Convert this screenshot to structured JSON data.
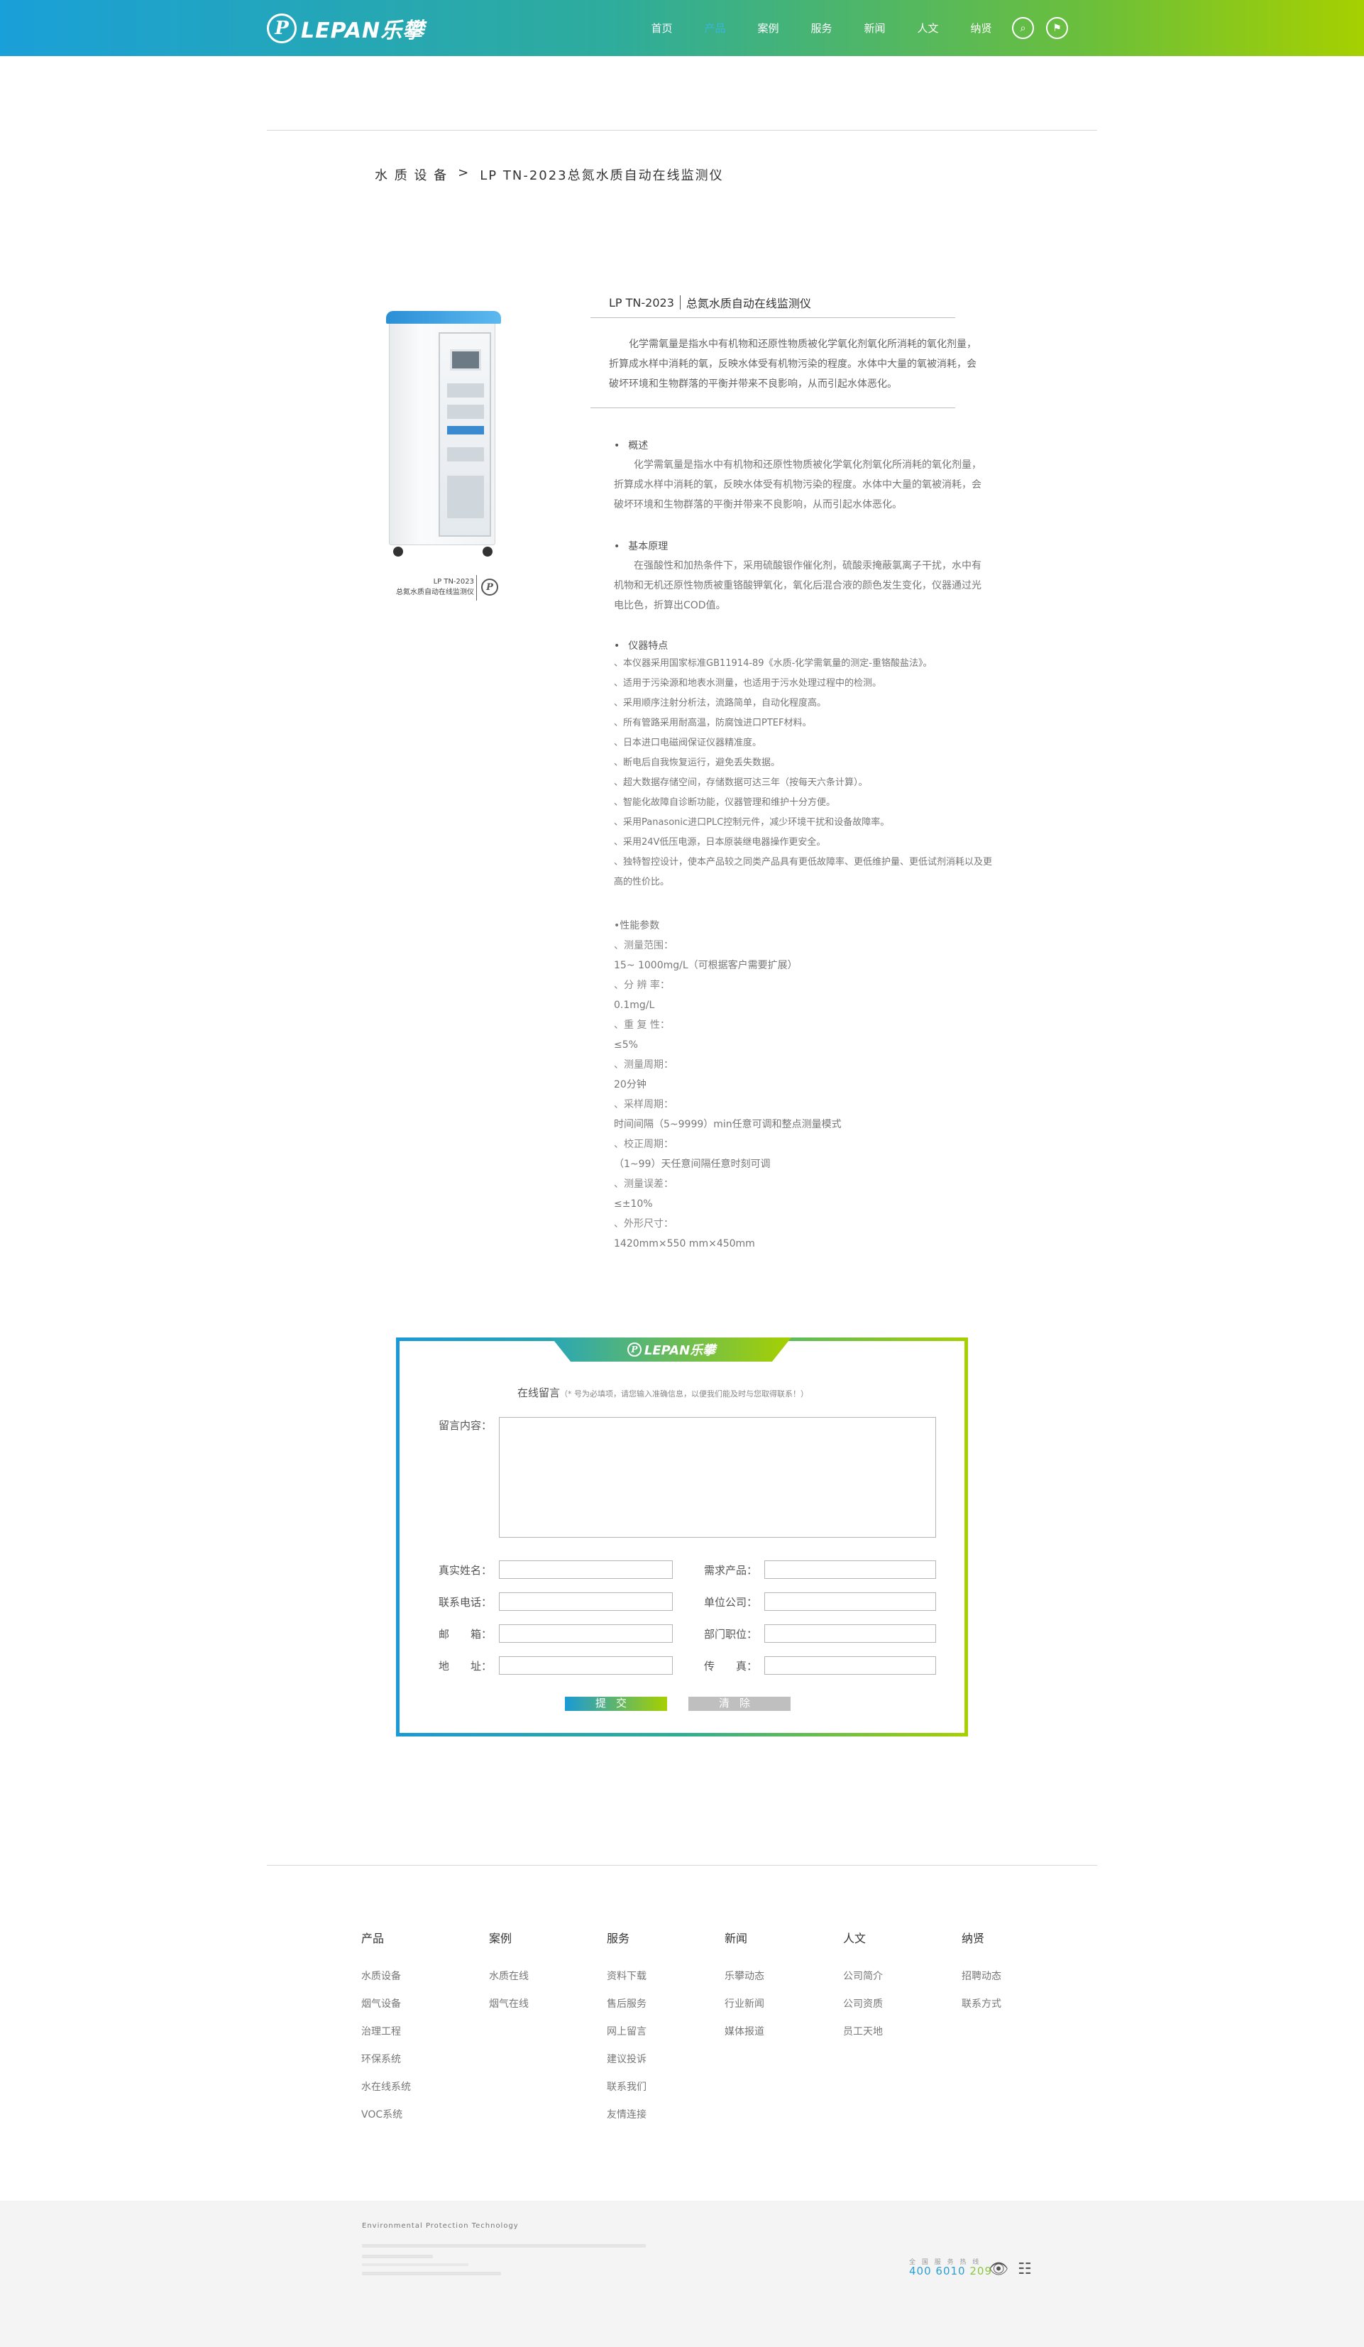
{
  "header": {
    "logo_text": "LEPAN乐攀",
    "logo_mark": "P",
    "nav": [
      "首页",
      "产品",
      "案例",
      "服务",
      "新闻",
      "人文",
      "纳贤"
    ],
    "active_index": 1,
    "search_icon": "search-icon",
    "flag_icon": "flag-icon"
  },
  "breadcrumb": {
    "category": "水 质 设 备",
    "separator": ">",
    "current": "LP TN-2023总氮水质自动在线监测仪"
  },
  "product": {
    "image_caption_model": "LP TN-2023",
    "image_caption_name": "总氮水质自动在线监测仪",
    "title_model": "LP TN-2023",
    "title_name": "总氮水质自动在线监测仪",
    "intro": "化学需氧量是指水中有机物和还原性物质被化学氧化剂氧化所消耗的氧化剂量，折算成水样中消耗的氧，反映水体受有机物污染的程度。水体中大量的氧被消耗，会破坏环境和生物群落的平衡并带来不良影响，从而引起水体恶化。",
    "overview_title": "概述",
    "overview_text": "化学需氧量是指水中有机物和还原性物质被化学氧化剂氧化所消耗的氧化剂量，折算成水样中消耗的氧，反映水体受有机物污染的程度。水体中大量的氧被消耗，会破坏环境和生物群落的平衡并带来不良影响，从而引起水体恶化。",
    "principle_title": "基本原理",
    "principle_text": "在强酸性和加热条件下，采用硫酸银作催化剂，硫酸汞掩蔽氯离子干扰，水中有机物和无机还原性物质被重铬酸钾氧化，氧化后混合液的颜色发生变化，仪器通过光电比色，折算出COD值。",
    "features_title": "仪器特点",
    "features": [
      "、本仪器采用国家标准GB11914-89《水质-化学需氧量的测定-重铬酸盐法》。",
      "、适用于污染源和地表水测量，也适用于污水处理过程中的检测。",
      "、采用顺序注射分析法，流路简单，自动化程度高。",
      "、所有管路采用耐高温，防腐蚀进口PTEF材料。",
      "、日本进口电磁阀保证仪器精准度。",
      "、断电后自我恢复运行，避免丢失数据。",
      "、超大数据存储空间，存储数据可达三年（按每天六条计算）。",
      "、智能化故障自诊断功能，仪器管理和维护十分方便。",
      "、采用Panasonic进口PLC控制元件，减少环境干扰和设备故障率。",
      "、采用24V低压电源，日本原装继电器操作更安全。",
      "、独特智控设计，使本产品较之同类产品具有更低故障率、更低维护量、更低试剂消耗以及更高的性价比。"
    ],
    "specs_title": "•性能参数",
    "specs": [
      {
        "label": "、测量范围：",
        "value": "15~ 1000mg/L（可根据客户需要扩展）"
      },
      {
        "label": "、分 辨 率：",
        "value": "0.1mg/L"
      },
      {
        "label": "、重 复 性：",
        "value": "≤5%"
      },
      {
        "label": "、测量周期：",
        "value": "20分钟"
      },
      {
        "label": "、采样周期：",
        "value": "时间间隔（5~9999）min任意可调和整点测量模式"
      },
      {
        "label": "、校正周期：",
        "value": "（1~99）天任意间隔任意时刻可调"
      },
      {
        "label": "、测量误差：",
        "value": "≤±10%"
      },
      {
        "label": "、外形尺寸：",
        "value": "1420mm×550 mm×450mm"
      }
    ]
  },
  "form": {
    "banner_text": "LEPAN乐攀",
    "heading": "在线留言",
    "note": "（* 号为必填项，请您输入准确信息，以便我们能及时与您取得联系！）",
    "content_label": "留言内容：",
    "labels": {
      "name": "真实姓名：",
      "product": "需求产品：",
      "phone": "联系电话：",
      "company": "单位公司：",
      "email": "邮　　箱：",
      "department": "部门职位：",
      "address": "地　　址：",
      "fax": "传　　真："
    },
    "submit": "提交",
    "clear": "清除"
  },
  "footer_nav": [
    {
      "title": "产品",
      "items": [
        "水质设备",
        "烟气设备",
        "治理工程",
        "环保系统",
        "水在线系统",
        "VOC系统"
      ]
    },
    {
      "title": "案例",
      "items": [
        "水质在线",
        "烟气在线"
      ]
    },
    {
      "title": "服务",
      "items": [
        "资料下载",
        "售后服务",
        "网上留言",
        "建议投诉",
        "联系我们",
        "友情连接"
      ]
    },
    {
      "title": "新闻",
      "items": [
        "乐攀动态",
        "行业新闻",
        "媒体报道"
      ]
    },
    {
      "title": "人文",
      "items": [
        "公司简介",
        "公司资质",
        "员工天地"
      ]
    },
    {
      "title": "纳贤",
      "items": [
        "招聘动态",
        "联系方式"
      ]
    }
  ],
  "footer": {
    "brand": "Environmental Protection Technology",
    "hotline_label": "全 国 服 务 热 线",
    "hotline": "400 6010 209",
    "weibo_icon": "weibo-icon",
    "wechat_icon": "wechat-icon",
    "colors": {
      "hotline_blue": "#2a9fd6",
      "hotline_green": "#8cc63f"
    }
  },
  "colors": {
    "header_start": "#1aa0d8",
    "header_end": "#a6d000",
    "nav_active": "#3ab5d9"
  }
}
